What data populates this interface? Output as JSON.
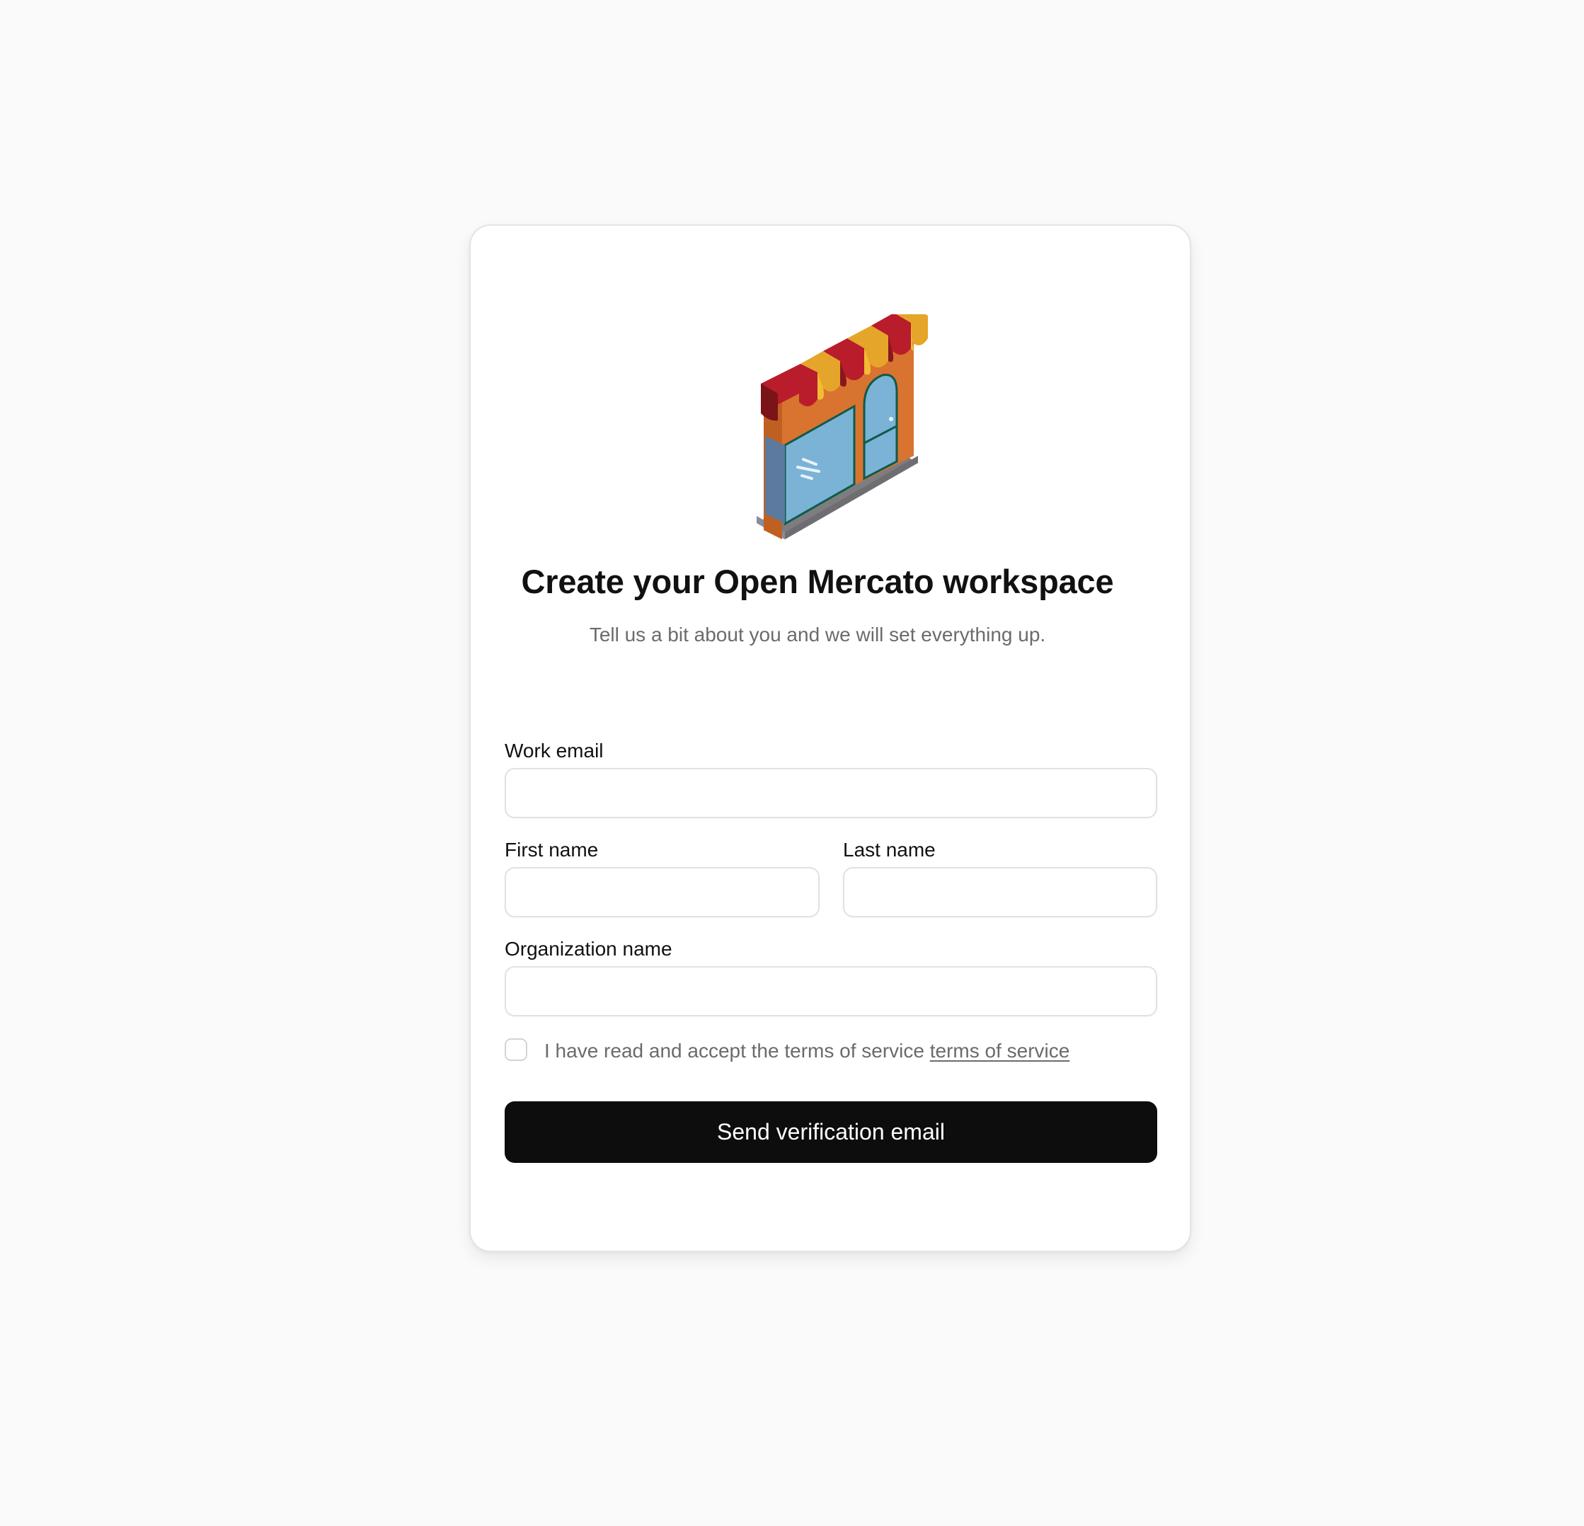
{
  "page": {
    "background_color": "#fafafa"
  },
  "logo": {
    "icon": "storefront-icon",
    "colors": {
      "wall": "#d97330",
      "awning_red": "#b91c2a",
      "awning_yellow": "#e5a52a",
      "glass": "#7ab3d6",
      "base": "#7a7a7a"
    }
  },
  "header": {
    "title": "Create your Open Mercato workspace",
    "subtitle": "Tell us a bit about you and we will set everything up."
  },
  "form": {
    "work_email": {
      "label": "Work email",
      "value": "",
      "placeholder": ""
    },
    "first_name": {
      "label": "First name",
      "value": "",
      "placeholder": ""
    },
    "last_name": {
      "label": "Last name",
      "value": "",
      "placeholder": ""
    },
    "organization_name": {
      "label": "Organization name",
      "value": "",
      "placeholder": ""
    },
    "terms": {
      "checked": false,
      "text": "I have read and accept the terms of service",
      "link_text": "terms of service"
    },
    "submit_label": "Send verification email",
    "submit_color": "#0d0d0d"
  }
}
